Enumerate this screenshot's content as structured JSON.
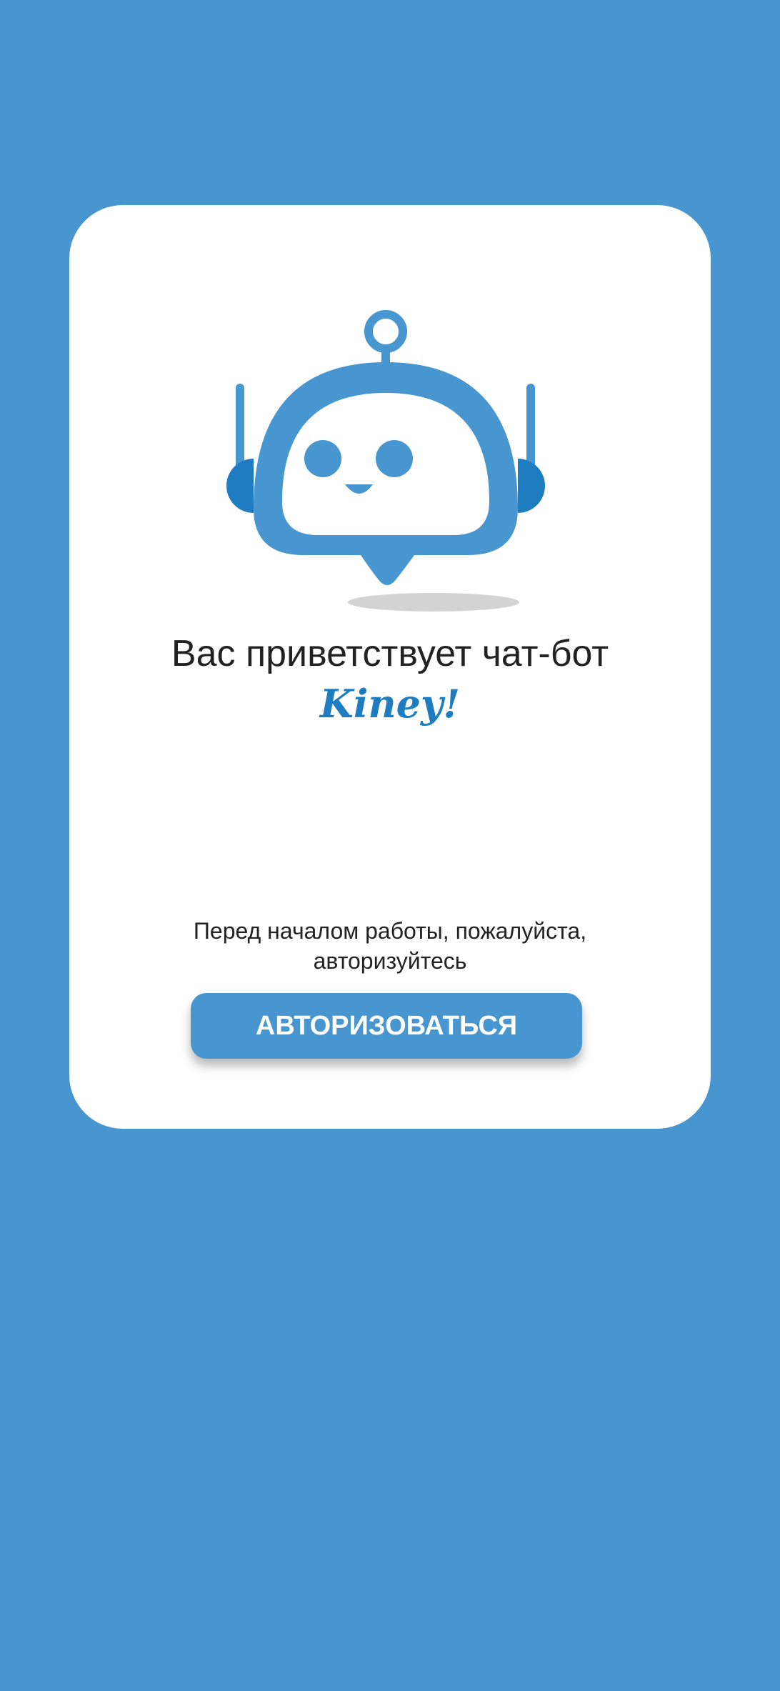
{
  "welcome": {
    "title": "Вас приветствует чат-бот",
    "brand": "Kiney!",
    "prompt_line1": "Перед началом работы, пожалуйста,",
    "prompt_line2": "авторизуйтесь",
    "button_label": "АВТОРИЗОВАТЬСЯ"
  },
  "icons": {
    "mascot": "robot-mascot-icon"
  },
  "colors": {
    "background": "#4896d0",
    "card": "#ffffff",
    "brand": "#1e7cc0",
    "robot_dark": "#1e7cc0",
    "text": "#222222"
  }
}
